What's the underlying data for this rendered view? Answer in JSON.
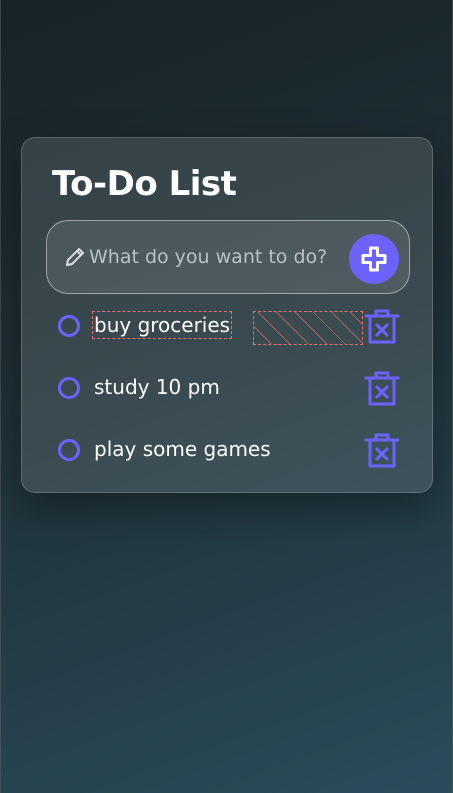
{
  "app": {
    "title": "To-Do List"
  },
  "input": {
    "placeholder": "What do you want to do?",
    "value": ""
  },
  "tasks": [
    {
      "label": "buy groceries"
    },
    {
      "label": "study 10 pm"
    },
    {
      "label": "play some games"
    }
  ],
  "icons": {
    "edit": "pencil-icon",
    "add": "plus-icon",
    "task_status": "circle-icon",
    "delete": "trash-x-icon"
  },
  "colors": {
    "accent": "#6c63ff",
    "text": "#ffffff",
    "placeholder": "#b9c3c6",
    "background_start": "#172327",
    "background_end": "#2a4c5a"
  }
}
